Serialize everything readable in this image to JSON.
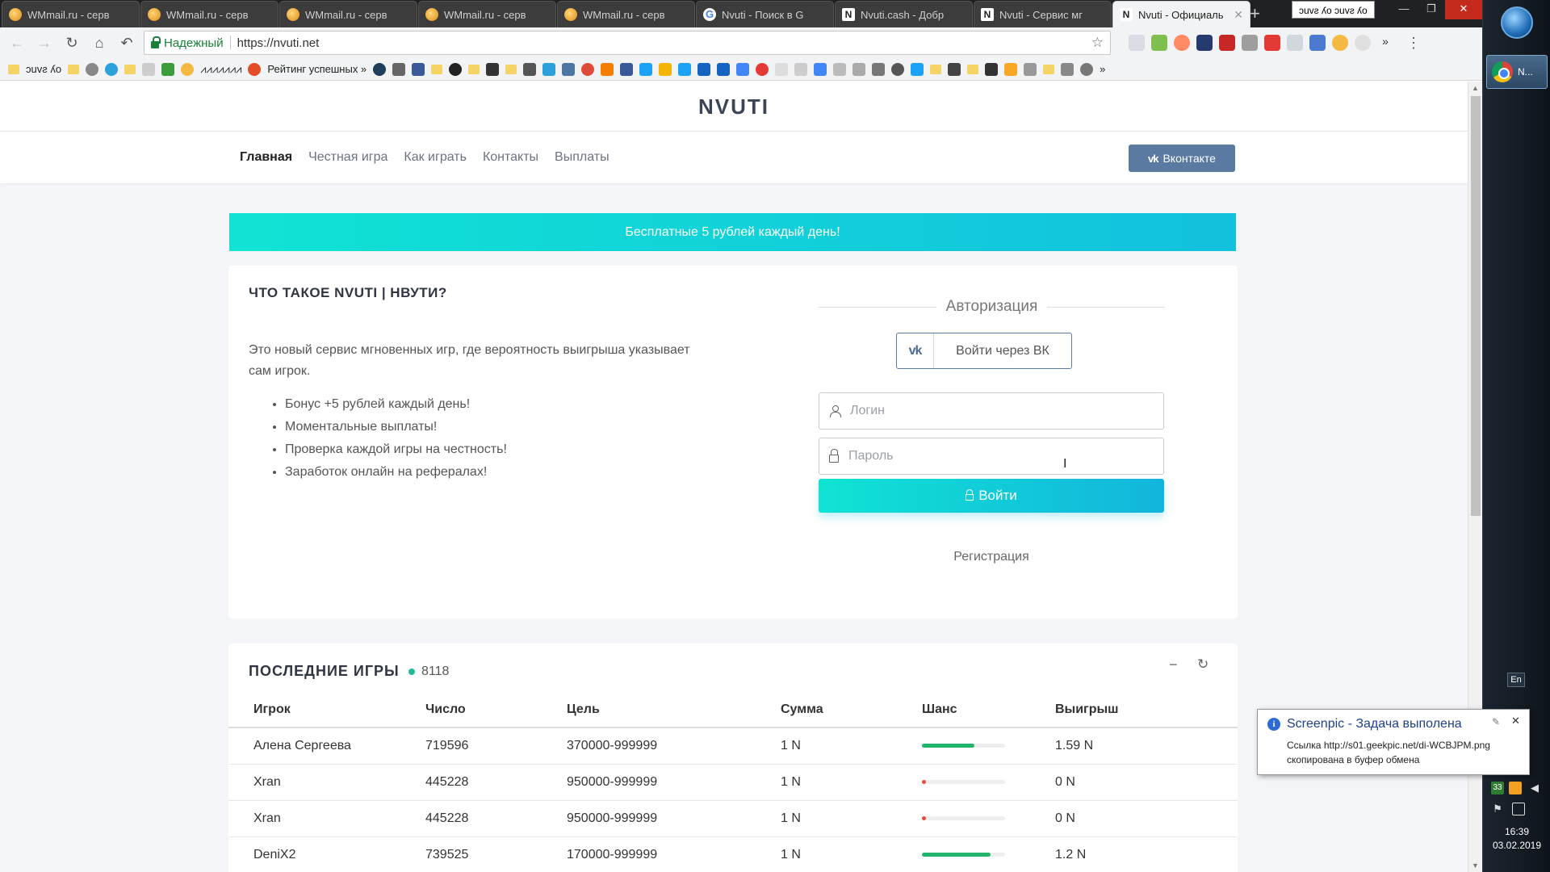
{
  "browser": {
    "tabs": [
      {
        "title": "WMmail.ru - серв",
        "icon": "wmmail-icon"
      },
      {
        "title": "WMmail.ru - серв",
        "icon": "wmmail-icon"
      },
      {
        "title": "WMmail.ru - серв",
        "icon": "wmmail-icon"
      },
      {
        "title": "WMmail.ru - серв",
        "icon": "wmmail-icon"
      },
      {
        "title": "WMmail.ru - серв",
        "icon": "wmmail-icon"
      },
      {
        "title": "Nvuti - Поиск в G",
        "icon": "google-icon"
      },
      {
        "title": "Nvuti.cash - Добр",
        "icon": "n-icon"
      },
      {
        "title": "Nvuti - Сервис мг",
        "icon": "n-icon"
      },
      {
        "title": "Nvuti - Официаль",
        "icon": "n-icon",
        "active": true
      }
    ],
    "profile_label": "ɔuvƨ ʎo ɔuvƨ ʎo",
    "secure_label": "Надежный",
    "url": "https://nvuti.net",
    "bookmarks": {
      "first_label": "ɔuvƨ ʎo",
      "pattern_label": "⩘⩘⩘⩘⩘⩘⩘",
      "rating_label": "Рейтинг успешных »"
    }
  },
  "site": {
    "logo": "NVUTI",
    "nav": [
      "Главная",
      "Честная игра",
      "Как играть",
      "Контакты",
      "Выплаты"
    ],
    "vk_button": "Вконтакте",
    "banner": "Бесплатные 5 рублей каждый день!",
    "about": {
      "title": "ЧТО ТАКОЕ NVUTI | НВУТИ?",
      "text": "Это новый сервис мгновенных игр, где вероятность выигрыша указывает сам игрок.",
      "bullets": [
        "Бонус +5 рублей каждый день!",
        "Моментальные выплаты!",
        "Проверка каждой игры на честность!",
        "Заработок онлайн на рефералах!"
      ]
    },
    "auth": {
      "title": "Авторизация",
      "vk_login": "Войти через ВК",
      "login_placeholder": "Логин",
      "password_placeholder": "Пароль",
      "login_button": "Войти",
      "register": "Регистрация"
    },
    "games": {
      "title": "ПОСЛЕДНИЕ ИГРЫ",
      "count": "8118",
      "columns": [
        "Игрок",
        "Число",
        "Цель",
        "Сумма",
        "Шанс",
        "Выигрыш"
      ],
      "rows": [
        {
          "player": "Алена Сергеева",
          "number": "719596",
          "target": "370000-999999",
          "sum": "1 N",
          "chance": 0.63,
          "win": "1.59 N",
          "won": true
        },
        {
          "player": "Xran",
          "number": "445228",
          "target": "950000-999999",
          "sum": "1 N",
          "chance": 0.05,
          "win": "0 N",
          "won": false
        },
        {
          "player": "Xran",
          "number": "445228",
          "target": "950000-999999",
          "sum": "1 N",
          "chance": 0.05,
          "win": "0 N",
          "won": false
        },
        {
          "player": "DeniX2",
          "number": "739525",
          "target": "170000-999999",
          "sum": "1 N",
          "chance": 0.83,
          "win": "1.2 N",
          "won": true
        }
      ]
    }
  },
  "taskbar": {
    "task_label": "N...",
    "lang": "En",
    "tray_badge": "33",
    "time": "16:39",
    "date": "03.02.2019"
  },
  "notification": {
    "title": "Screenpic - Задача выполена",
    "body_line1": "Ссылка http://s01.geekpic.net/di-WCBJPM.png",
    "body_line2": "скопирована в буфер обмена"
  },
  "colors": {
    "accent": "#12c1dd",
    "win_green": "#20b56a",
    "lose_red": "#e74c3c",
    "vk_blue": "#5b7aa1"
  }
}
